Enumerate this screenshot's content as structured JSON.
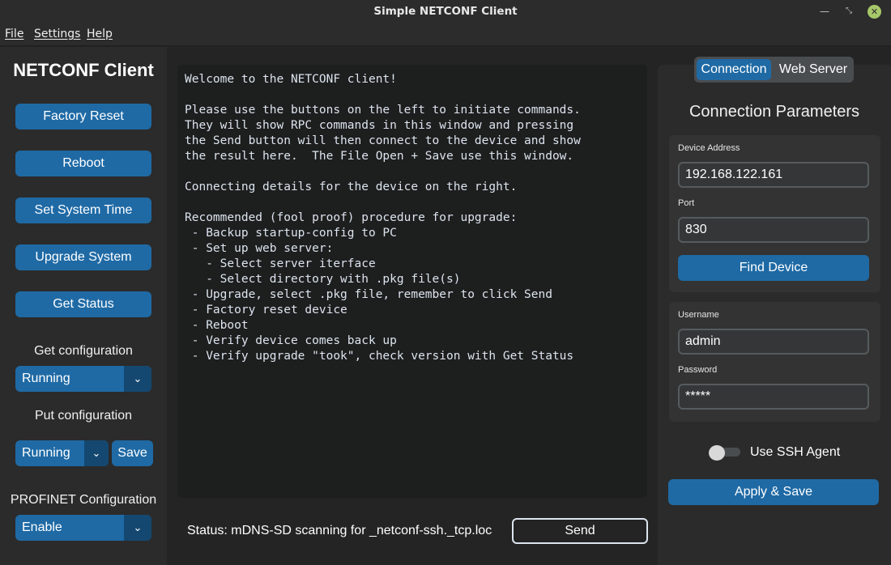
{
  "window": {
    "title": "Simple NETCONF Client",
    "minimize_icon": "—",
    "maximize_icon": "⤡",
    "close_icon": "✕"
  },
  "menu": [
    "File",
    "Settings",
    "Help"
  ],
  "sidebar": {
    "title": "NETCONF Client",
    "buttons": [
      "Factory Reset",
      "Reboot",
      "Set System Time",
      "Upgrade System",
      "Get Status"
    ],
    "get_config": {
      "label": "Get configuration",
      "value": "Running"
    },
    "put_config": {
      "label": "Put configuration",
      "value": "Running",
      "save_label": "Save"
    },
    "profinet": {
      "label": "PROFINET Configuration",
      "value": "Enable"
    }
  },
  "output": {
    "text": "Welcome to the NETCONF client!\n\nPlease use the buttons on the left to initiate commands.\nThey will show RPC commands in this window and pressing\nthe Send button will then connect to the device and show\nthe result here.  The File Open + Save use this window.\n\nConnecting details for the device on the right.\n\nRecommended (fool proof) procedure for upgrade:\n - Backup startup-config to PC\n - Set up web server:\n   - Select server iterface\n   - Select directory with .pkg file(s)\n - Upgrade, select .pkg file, remember to click Send\n - Factory reset device\n - Reboot\n - Verify device comes back up\n - Verify upgrade \"took\", check version with Get Status"
  },
  "status": {
    "text": "Status: mDNS-SD scanning for _netconf-ssh._tcp.local"
  },
  "send_label": "Send",
  "right_panel": {
    "tabs": [
      "Connection",
      "Web Server"
    ],
    "active_tab": "Connection",
    "title": "Connection Parameters",
    "device_address": {
      "label": "Device Address",
      "value": "192.168.122.161"
    },
    "port": {
      "label": "Port",
      "value": "830"
    },
    "find_device_label": "Find Device",
    "username": {
      "label": "Username",
      "value": "admin"
    },
    "password": {
      "label": "Password",
      "value": "*****"
    },
    "ssh_agent": {
      "label": "Use SSH Agent",
      "enabled": false
    },
    "apply_label": "Apply & Save"
  },
  "colors": {
    "accent": "#1f6aa5",
    "accent_dark": "#144870",
    "background": "#242424",
    "panel": "#2b2b2b"
  }
}
